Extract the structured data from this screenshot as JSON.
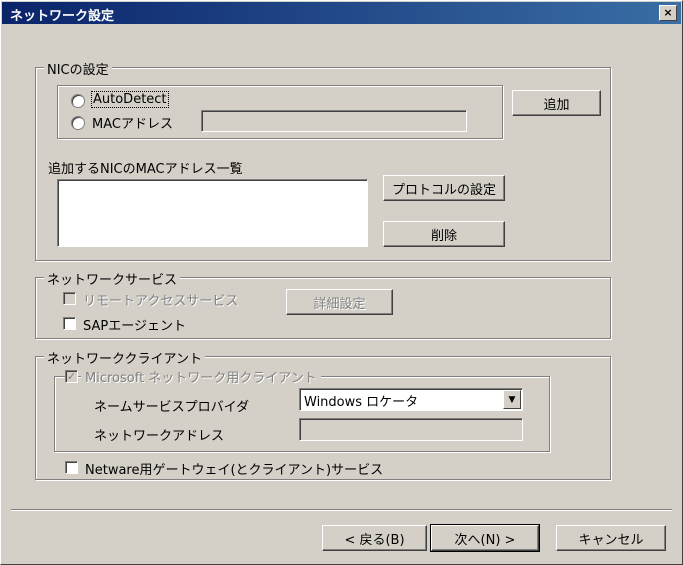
{
  "window": {
    "title": "ネットワーク設定",
    "close_glyph": "×"
  },
  "nic_group": {
    "legend": "NICの設定",
    "radio_autodetect": "AutoDetect",
    "radio_mac": "MACアドレス",
    "mac_input_value": "",
    "add_button": "追加",
    "list_label": "追加するNICのMACアドレス一覧",
    "list_items": [],
    "protocol_button": "プロトコルの設定",
    "delete_button": "削除"
  },
  "service_group": {
    "legend": "ネットワークサービス",
    "remote_access": "リモートアクセスサービス",
    "detail_button": "詳細設定",
    "sap_agent": "SAPエージェント"
  },
  "client_group": {
    "legend": "ネットワーククライアント",
    "ms_client": "Microsoft ネットワーク用クライアント",
    "name_service_label": "ネームサービスプロバイダ",
    "name_service_value": "Windows ロケータ",
    "network_address_label": "ネットワークアドレス",
    "network_address_value": "",
    "netware": "Netware用ゲートウェイ(とクライアント)サービス"
  },
  "footer": {
    "back_button": "< 戻る(B)",
    "next_button": "次へ(N) >",
    "cancel_button": "キャンセル"
  }
}
